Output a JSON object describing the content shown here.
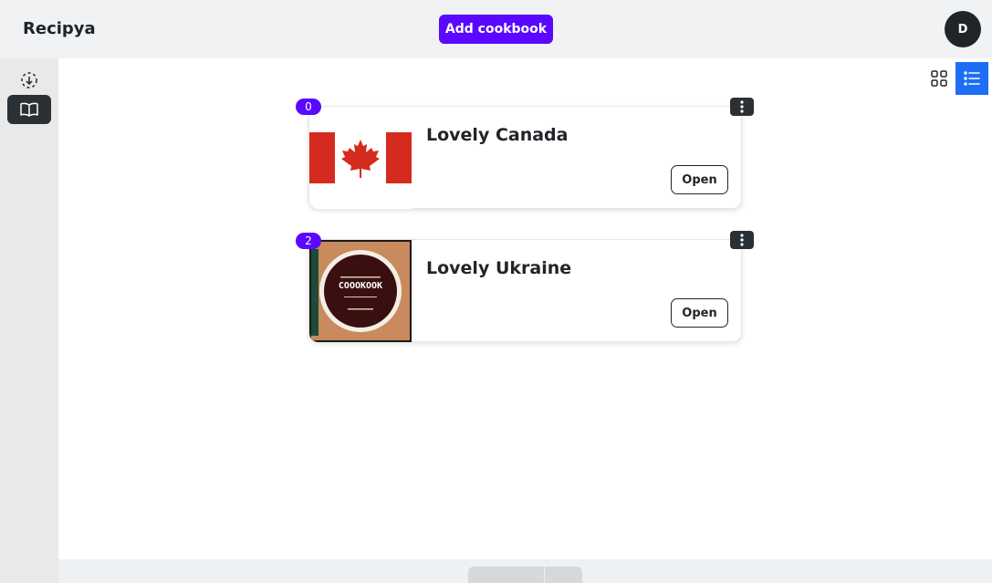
{
  "header": {
    "brand": "Recipya",
    "add_button_label": "Add cookbook",
    "avatar_initial": "D"
  },
  "sidebar": {
    "items": [
      {
        "icon": "select-icon",
        "active": false
      },
      {
        "icon": "book-open-icon",
        "active": true
      }
    ]
  },
  "view_toggle": {
    "options": [
      "grid-icon",
      "list-icon"
    ],
    "active": "list"
  },
  "cookbooks": [
    {
      "index": "0",
      "title": "Lovely Canada",
      "image": "canada-flag",
      "open_label": "Open"
    },
    {
      "index": "2",
      "title": "Lovely Ukraine",
      "image": "cookbook-cover",
      "open_label": "Open"
    }
  ],
  "colors": {
    "accent": "#5a08ff",
    "view_active": "#1d6ef5",
    "dark": "#2b3035"
  }
}
